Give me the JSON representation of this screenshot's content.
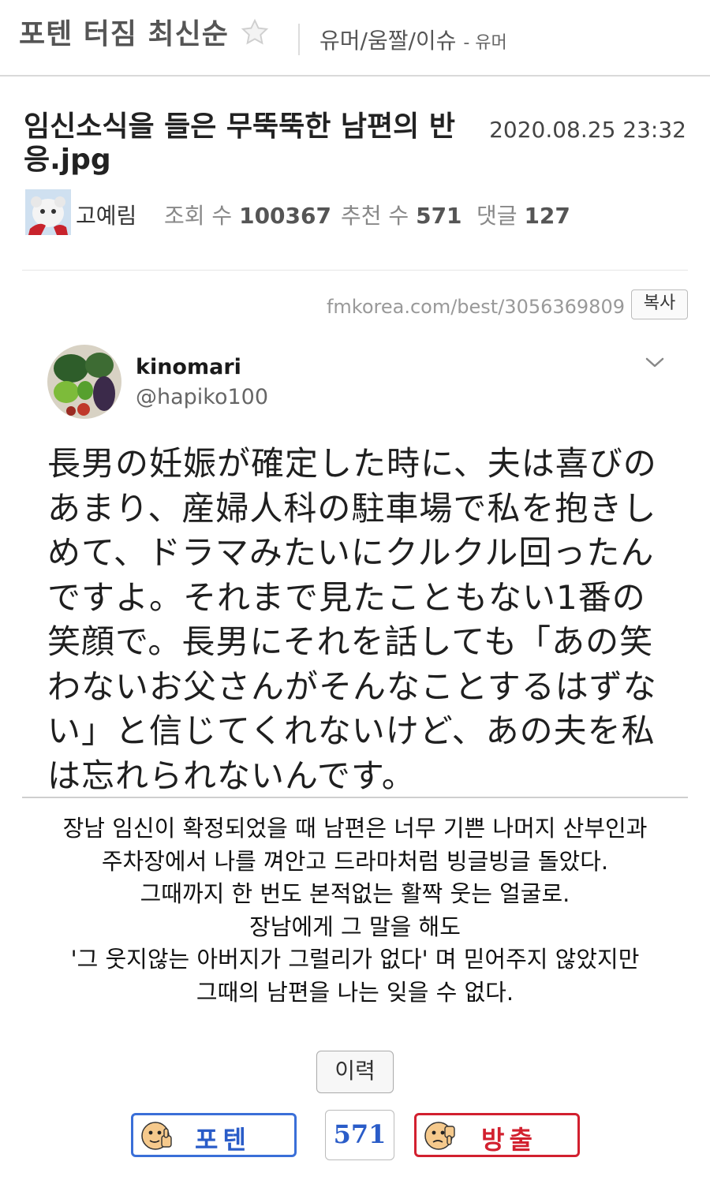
{
  "header": {
    "board_title": "포텐 터짐 최신순",
    "category": "유머/움짤/이슈",
    "subcategory": "- 유머"
  },
  "post": {
    "title": "임신소식을 들은 무뚝뚝한 남편의 반응.jpg",
    "date": "2020.08.25 23:32",
    "author": "고예림",
    "views_label": "조회 수",
    "views": "100367",
    "votes_label": "추천 수",
    "votes": "571",
    "comments_label": "댓글",
    "comments": "127",
    "url": "fmkorea.com/best/3056369809",
    "copy_label": "복사"
  },
  "tweet": {
    "name": "kinomari",
    "handle": "@hapiko100",
    "lines": [
      "長男の妊娠が確定した時に、夫は喜びの",
      "あまり、産婦人科の駐車場で私を抱きし",
      "めて、ドラマみたいにクルクル回ったん",
      "ですよ。それまで見たこともない1番の",
      "笑顔で。長男にそれを話しても「あの笑",
      "わないお父さんがそんなことするはずな",
      "い」と信じてくれないけど、あの夫を私",
      "は忘れられないんです。"
    ]
  },
  "translation": {
    "lines": [
      "장남 임신이 확정되었을 때 남편은 너무 기쁜 나머지 산부인과",
      "주차장에서 나를 껴안고 드라마처럼 빙글빙글 돌았다.",
      "그때까지 한 번도 본적없는 활짝 웃는 얼굴로.",
      "장남에게 그 말을 해도",
      "'그 웃지않는 아버지가 그럴리가 없다' 며 믿어주지 않았지만",
      "그때의 남편을 나는 잊을 수 없다."
    ]
  },
  "actions": {
    "history_label": "이력",
    "vote_up_label": "포텐",
    "vote_count": "571",
    "vote_down_label": "방출"
  },
  "colors": {
    "vote_up": "#3a6fd8",
    "vote_down": "#d2202f"
  }
}
